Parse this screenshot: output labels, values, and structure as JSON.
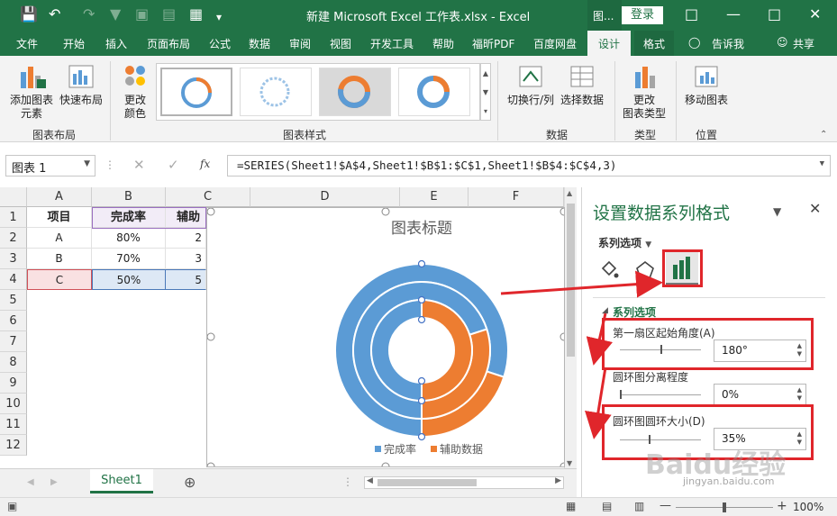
{
  "window": {
    "title": "新建 Microsoft Excel 工作表.xlsx  -  Excel",
    "context_label": "图...",
    "login_label": "登录"
  },
  "tabs": [
    "文件",
    "开始",
    "插入",
    "页面布局",
    "公式",
    "数据",
    "审阅",
    "视图",
    "开发工具",
    "帮助",
    "福昕PDF",
    "百度网盘",
    "设计",
    "格式"
  ],
  "tell_me": "告诉我",
  "share": "共享",
  "ribbon": {
    "add_element": "添加图表\n元素",
    "quick_layout": "快速布局",
    "change_color": "更改\n颜色",
    "switch_row_col": "切换行/列",
    "select_data": "选择数据",
    "change_type": "更改\n图表类型",
    "move_chart": "移动图表",
    "group_layout": "图表布局",
    "group_styles": "图表样式",
    "group_data": "数据",
    "group_type": "类型",
    "group_location": "位置"
  },
  "formula_bar": {
    "name_box": "图表 1",
    "fx": "fx",
    "formula": "=SERIES(Sheet1!$A$4,Sheet1!$B$1:$C$1,Sheet1!$B$4:$C$4,3)"
  },
  "columns": [
    "A",
    "B",
    "C",
    "D",
    "E",
    "F"
  ],
  "rows": [
    "1",
    "2",
    "3",
    "4",
    "5",
    "6",
    "7",
    "8",
    "9",
    "10",
    "11",
    "12"
  ],
  "table": {
    "header": [
      "项目",
      "完成率",
      "辅助"
    ],
    "data": [
      [
        "A",
        "80%",
        "2"
      ],
      [
        "B",
        "70%",
        "3"
      ],
      [
        "C",
        "50%",
        "5"
      ]
    ]
  },
  "chart_data": {
    "type": "pie",
    "subtype": "doughnut",
    "title": "图表标题",
    "categories": [
      "完成率",
      "辅助数据"
    ],
    "series": [
      {
        "name": "A",
        "values": [
          80,
          20
        ]
      },
      {
        "name": "B",
        "values": [
          70,
          30
        ]
      },
      {
        "name": "C",
        "values": [
          50,
          50
        ]
      }
    ],
    "colors": [
      "#5b9bd5",
      "#ed7d31"
    ],
    "first_slice_angle": 180,
    "legend": "bottom"
  },
  "sheet_tab": "Sheet1",
  "pane": {
    "title": "设置数据系列格式",
    "dropdown": "系列选项",
    "section": "系列选项",
    "angle_label": "第一扇区起始角度(A)",
    "angle_value": "180°",
    "angle_fraction": 0.5,
    "explosion_label": "圆环图分离程度",
    "explosion_value": "0%",
    "explosion_fraction": 0,
    "hole_label": "圆环图圆环大小(D)",
    "hole_value": "35%",
    "hole_fraction": 0.35
  },
  "status": {
    "zoom": "100%"
  },
  "watermark": {
    "text": "Baidu经验",
    "url": "jingyan.baidu.com"
  },
  "accent": "#217346",
  "highlight": "#e0262b"
}
